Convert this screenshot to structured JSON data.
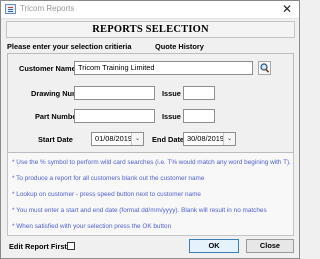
{
  "window": {
    "title": "Tricom Reports",
    "close_glyph": "✕",
    "icon": "app-icon"
  },
  "heading": "REPORTS SELECTION",
  "criteria_label": "Please enter your selection critieria",
  "quote_history_label": "Quote History",
  "fields": {
    "customer_name": {
      "label": "Customer Name",
      "value": "Tricom Training Limited",
      "lookup_icon": "magnifier-icon"
    },
    "drawing_number": {
      "label": "Drawing Number",
      "value": ""
    },
    "drawing_issue": {
      "label": "Issue",
      "value": ""
    },
    "part_number": {
      "label": "Part Number",
      "value": ""
    },
    "part_issue": {
      "label": "Issue",
      "value": ""
    },
    "start_date": {
      "label": "Start Date",
      "value": "01/08/2019"
    },
    "end_date": {
      "label": "End Date",
      "value": "30/08/2019"
    },
    "dropdown_glyph": "⌄"
  },
  "notes": [
    "* Use the % symbol to perform wild card searches (i.e. T% would  match any word begining with T).",
    "* To produce a report for all customers blank out the customer name",
    "* Lookup on customer - press speed button next to customer name",
    "* You must enter a start and end date (format dd/mm/yyyy). Blank will result in no matches",
    "* When satisfied with your selection press the OK button"
  ],
  "footer": {
    "edit_report_first_label": "Edit Report First",
    "edit_report_first_checked": false,
    "ok_label": "OK",
    "close_label": "Close"
  },
  "colors": {
    "note_text": "#4d5fd0",
    "window_bg": "#f0f0f0"
  }
}
